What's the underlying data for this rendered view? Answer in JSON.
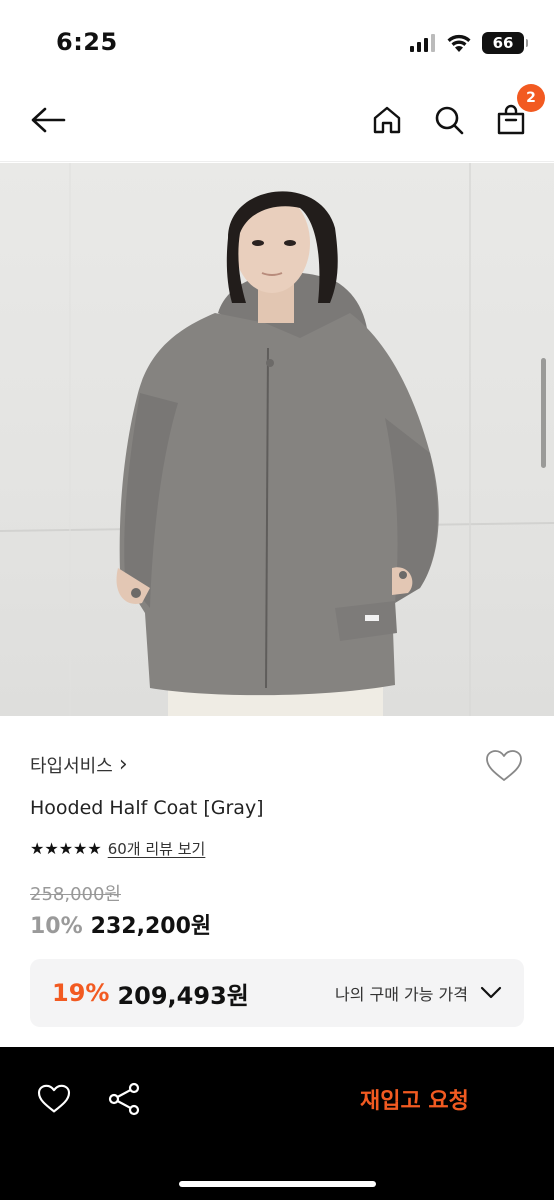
{
  "status_bar": {
    "time": "6:25",
    "battery": "66"
  },
  "nav": {
    "cart_count": "2"
  },
  "product": {
    "brand": "타입서비스",
    "brand_chevron": "›",
    "name": "Hooded Half Coat [Gray]",
    "rating_stars": 5,
    "reviews_label": "60개 리뷰 보기",
    "original_price": "258,000원",
    "discount_percent": "10%",
    "sale_price": "232,200원"
  },
  "my_price": {
    "percent": "19%",
    "price": "209,493원",
    "label": "나의 구매 가능 가격"
  },
  "bottom_bar": {
    "restock_label": "재입고 요청"
  },
  "colors": {
    "accent": "#f25a21",
    "bottom_bar": "#000000",
    "price_box": "#f4f4f5",
    "coat": "#858380"
  }
}
